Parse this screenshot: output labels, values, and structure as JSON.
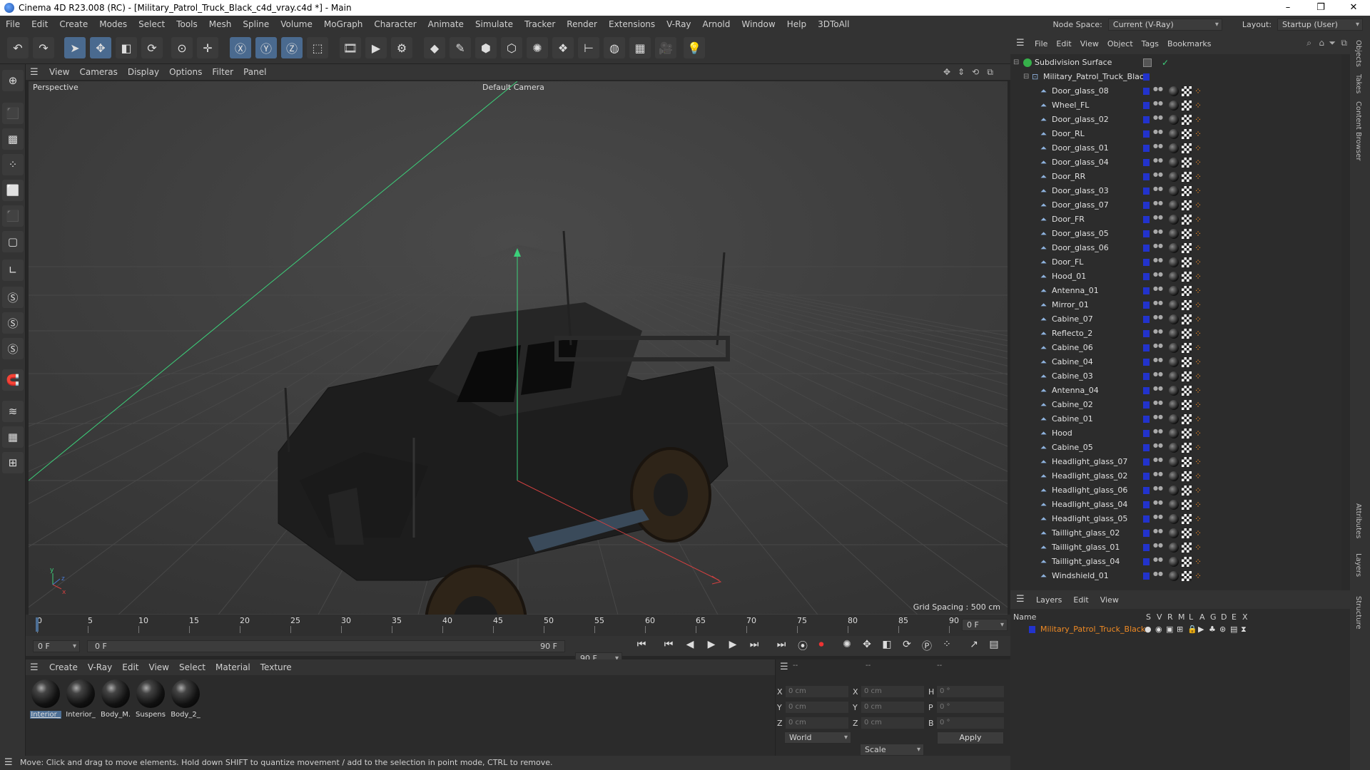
{
  "window": {
    "title": "Cinema 4D R23.008 (RC) - [Military_Patrol_Truck_Black_c4d_vray.c4d *] - Main",
    "controls": [
      "–",
      "❐",
      "✕"
    ]
  },
  "menubar": {
    "items": [
      "File",
      "Edit",
      "Create",
      "Modes",
      "Select",
      "Tools",
      "Mesh",
      "Spline",
      "Volume",
      "MoGraph",
      "Character",
      "Animate",
      "Simulate",
      "Tracker",
      "Render",
      "Extensions",
      "V-Ray",
      "Arnold",
      "Window",
      "Help",
      "3DToAll"
    ],
    "node_space_label": "Node Space:",
    "node_space_value": "Current (V-Ray)",
    "layout_label": "Layout:",
    "layout_value": "Startup (User)"
  },
  "viewport": {
    "menu": [
      "View",
      "Cameras",
      "Display",
      "Options",
      "Filter",
      "Panel"
    ],
    "view_name": "Perspective",
    "camera": "Default Camera",
    "grid_spacing": "Grid Spacing : 500 cm"
  },
  "timeline": {
    "ticks": [
      "0",
      "5",
      "10",
      "15",
      "20",
      "25",
      "30",
      "35",
      "40",
      "45",
      "50",
      "55",
      "60",
      "65",
      "70",
      "75",
      "80",
      "85",
      "90"
    ],
    "current_frame": "0 F"
  },
  "transport": {
    "start": "0 F",
    "range_start": "0 F",
    "range_end": "90 F",
    "end": "90 F"
  },
  "materials": {
    "menu": [
      "Create",
      "V-Ray",
      "Edit",
      "View",
      "Select",
      "Material",
      "Texture"
    ],
    "items": [
      "Interior_",
      "Interior_",
      "Body_M.",
      "Suspens",
      "Body_2_"
    ]
  },
  "coords": {
    "headers": [
      "--",
      "--",
      "--"
    ],
    "rows": [
      {
        "a": "X",
        "av": "0 cm",
        "b": "X",
        "bv": "0 cm",
        "c": "H",
        "cv": "0 °"
      },
      {
        "a": "Y",
        "av": "0 cm",
        "b": "Y",
        "bv": "0 cm",
        "c": "P",
        "cv": "0 °"
      },
      {
        "a": "Z",
        "av": "0 cm",
        "b": "Z",
        "bv": "0 cm",
        "c": "B",
        "cv": "0 °"
      }
    ],
    "mode1": "World",
    "mode2": "Scale",
    "apply": "Apply"
  },
  "status": "Move: Click and drag to move elements. Hold down SHIFT to quantize movement / add to the selection in point mode, CTRL to remove.",
  "objects": {
    "menu": [
      "File",
      "Edit",
      "View",
      "Object",
      "Tags",
      "Bookmarks"
    ],
    "root": "Subdivision Surface",
    "group": "Military_Patrol_Truck_Black",
    "items": [
      "Door_glass_08",
      "Wheel_FL",
      "Door_glass_02",
      "Door_RL",
      "Door_glass_01",
      "Door_glass_04",
      "Door_RR",
      "Door_glass_03",
      "Door_glass_07",
      "Door_FR",
      "Door_glass_05",
      "Door_glass_06",
      "Door_FL",
      "Hood_01",
      "Antenna_01",
      "Mirror_01",
      "Cabine_07",
      "Reflecto_2",
      "Cabine_06",
      "Cabine_04",
      "Cabine_03",
      "Antenna_04",
      "Cabine_02",
      "Cabine_01",
      "Hood",
      "Cabine_05",
      "Headlight_glass_07",
      "Headlight_glass_02",
      "Headlight_glass_06",
      "Headlight_glass_04",
      "Headlight_glass_05",
      "Taillight_glass_02",
      "Taillight_glass_01",
      "Taillight_glass_04",
      "Windshield_01"
    ]
  },
  "layers": {
    "menu": [
      "Layers",
      "Edit",
      "View"
    ],
    "col_name": "Name",
    "cols": [
      "S",
      "V",
      "R",
      "M",
      "L",
      "A",
      "G",
      "D",
      "E",
      "X"
    ],
    "layer_name": "Military_Patrol_Truck_Black"
  },
  "side_tabs": [
    "Objects",
    "Takes",
    "Content Browser",
    "Attributes",
    "Layers",
    "Structure"
  ],
  "colors": {
    "accent": "#4d6f95",
    "layer": "#2233cc",
    "layer_text": "#f08a24"
  }
}
